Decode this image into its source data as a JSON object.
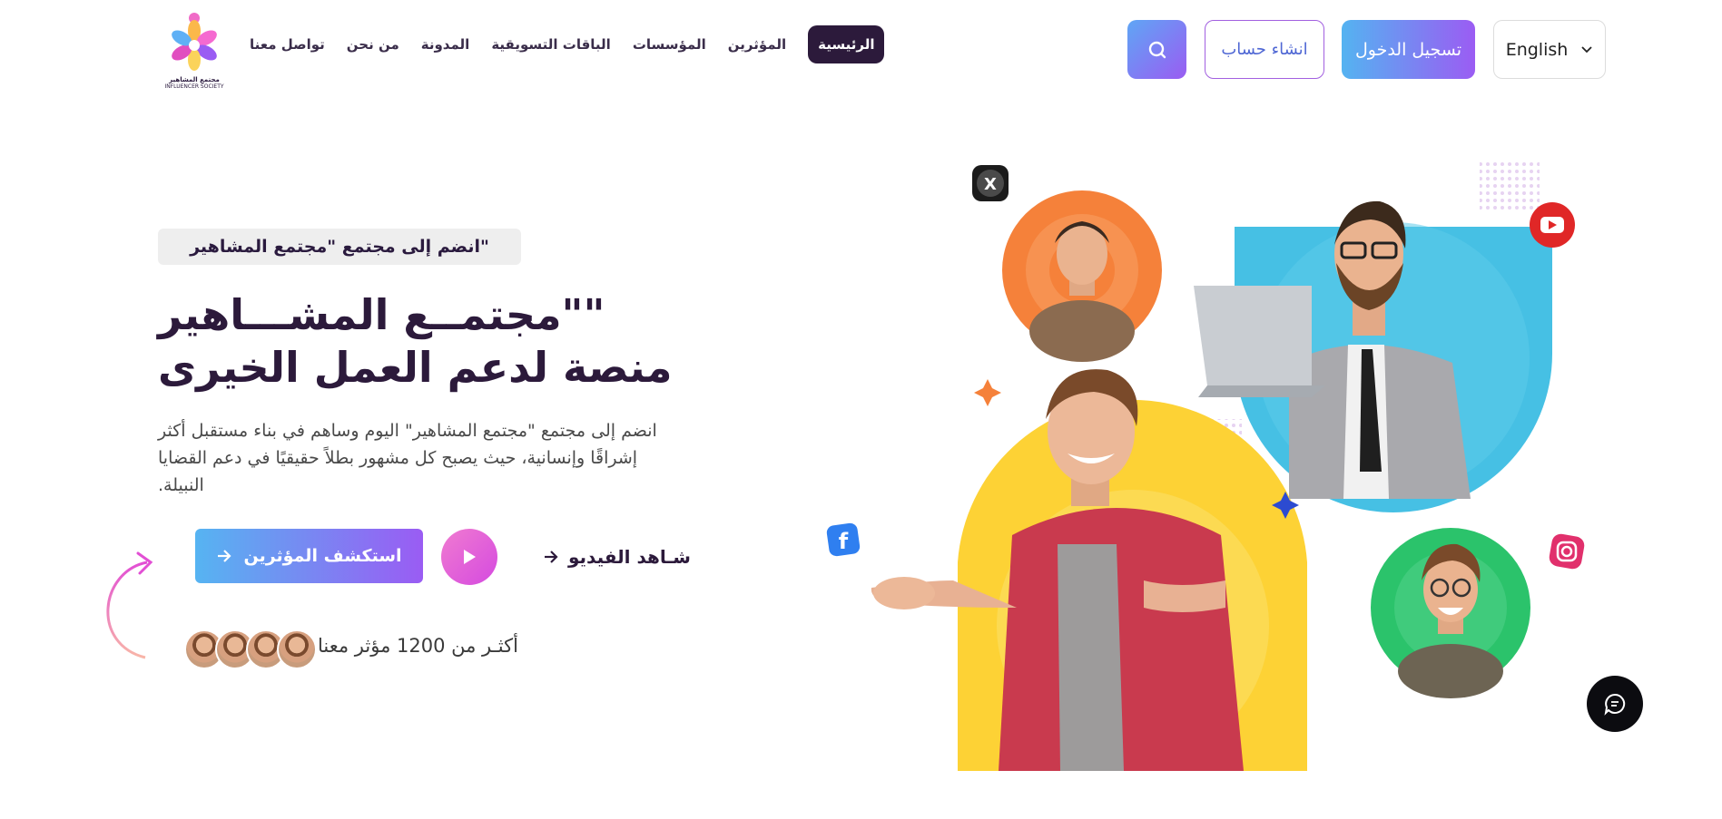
{
  "header": {
    "logo_title": "مجتمع المشاهير",
    "logo_subtitle": "INFLUENCER SOCIETY",
    "nav": [
      {
        "label": "الرئيسية",
        "active": true
      },
      {
        "label": "المؤثرين",
        "active": false
      },
      {
        "label": "المؤسسات",
        "active": false
      },
      {
        "label": "الباقات التسويقية",
        "active": false
      },
      {
        "label": "المدونة",
        "active": false
      },
      {
        "label": "من نحن",
        "active": false
      },
      {
        "label": "تواصل معنا",
        "active": false
      }
    ],
    "signup_label": "انشاء حساب",
    "login_label": "تسجيل الدخول",
    "language_label": "English"
  },
  "hero": {
    "pill": "\"انضم إلى مجتمع \"مجتمع المشاهير",
    "title_line1": "مجتمــع المشـــاهير\"\"",
    "title_line2": "منصة لدعم العمل الخيرى",
    "desc_line1": "انضم إلى مجتمع \"مجتمع المشاهير\" اليوم وساهم في بناء مستقبل أكثر",
    "desc_line2": "إشراقًا وإنسانية، حيث يصبح كل مشهور بطلاً حقيقيًا في دعم القضايا",
    "desc_line3": ".النبيلة",
    "explore_label": "استكشف المؤثرين",
    "watch_label": "شـاهد الفيديو",
    "influencers_count_text": "أكثـر من 1200 مؤثر معنا"
  },
  "icons": {
    "search": "search-icon",
    "chevron": "chevron-down-icon",
    "play": "play-icon",
    "arrow": "arrow-right-icon",
    "chat": "chat-icon",
    "social": [
      "x-icon",
      "youtube-icon",
      "facebook-icon",
      "instagram-icon"
    ]
  },
  "colors": {
    "primary_dark": "#2c1a3b",
    "gradient_start": "#56b4f2",
    "gradient_end": "#9a5cf3",
    "pink": "#e058d8",
    "orange_circle": "#f5813a",
    "blue_shape": "#46c0e4",
    "yellow_shape": "#fdd235",
    "green_circle": "#2bc36b"
  }
}
